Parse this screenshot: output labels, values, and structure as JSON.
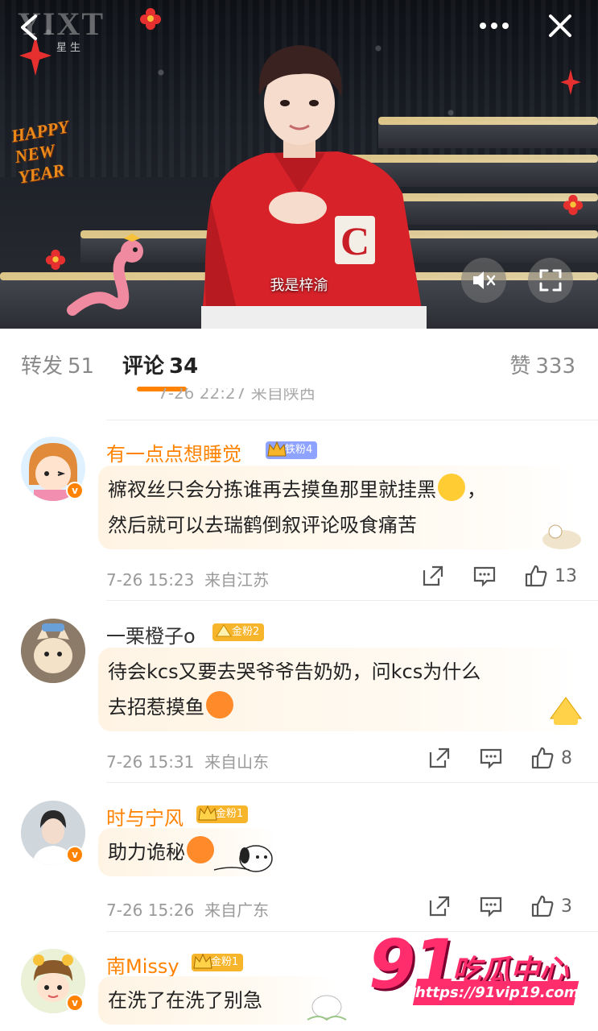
{
  "video": {
    "brand": "YIXT",
    "brand_sub": "星生",
    "subtitle": "我是梓渝",
    "sticker_text": [
      "HAPPY",
      "NEW",
      "YEAR"
    ]
  },
  "tabs": {
    "repost": {
      "label": "转发",
      "count": "51"
    },
    "comment": {
      "label": "评论",
      "count": "34"
    },
    "like": {
      "label": "赞",
      "count": "333"
    }
  },
  "partial_meta": "7-26 22:27 来自陕西",
  "comments": [
    {
      "username": "有一点点想睡觉",
      "fan_badge": "铁粉4",
      "lines": [
        "褯衩丝只会分拣谁再去摸鱼那里就挂黑",
        "，",
        "然后就可以去瑞鹤倒叙评论吸食痛苦"
      ],
      "time": "7-26 15:23",
      "location": "来自江苏",
      "likes": "13"
    },
    {
      "username": "一栗橙子o",
      "fan_badge": "金粉2",
      "lines": [
        "待会kcs又要去哭爷爷告奶奶，问kcs为什么",
        "去招惹摸鱼"
      ],
      "time": "7-26 15:31",
      "location": "来自山东",
      "likes": "8"
    },
    {
      "username": "时与宁风",
      "fan_badge": "金粉1",
      "lines": [
        "助力诡秘"
      ],
      "time": "7-26 15:26",
      "location": "来自广东",
      "likes": "3"
    },
    {
      "username": "南Missy",
      "fan_badge": "金粉1",
      "lines": [
        "在洗了在洗了别急"
      ]
    }
  ],
  "watermark": {
    "number": "91",
    "title": "吃瓜中心",
    "url": "https://91vip19.com"
  },
  "colors": {
    "accent": "#ff8200",
    "iron_badge": "#8ea3ff",
    "gold_badge": "#f6b52a",
    "watermark": "#ff2d6b"
  },
  "icons": [
    "back-icon",
    "more-icon",
    "close-icon",
    "mute-icon",
    "fullscreen-icon",
    "share-icon",
    "comment-icon",
    "like-icon"
  ]
}
